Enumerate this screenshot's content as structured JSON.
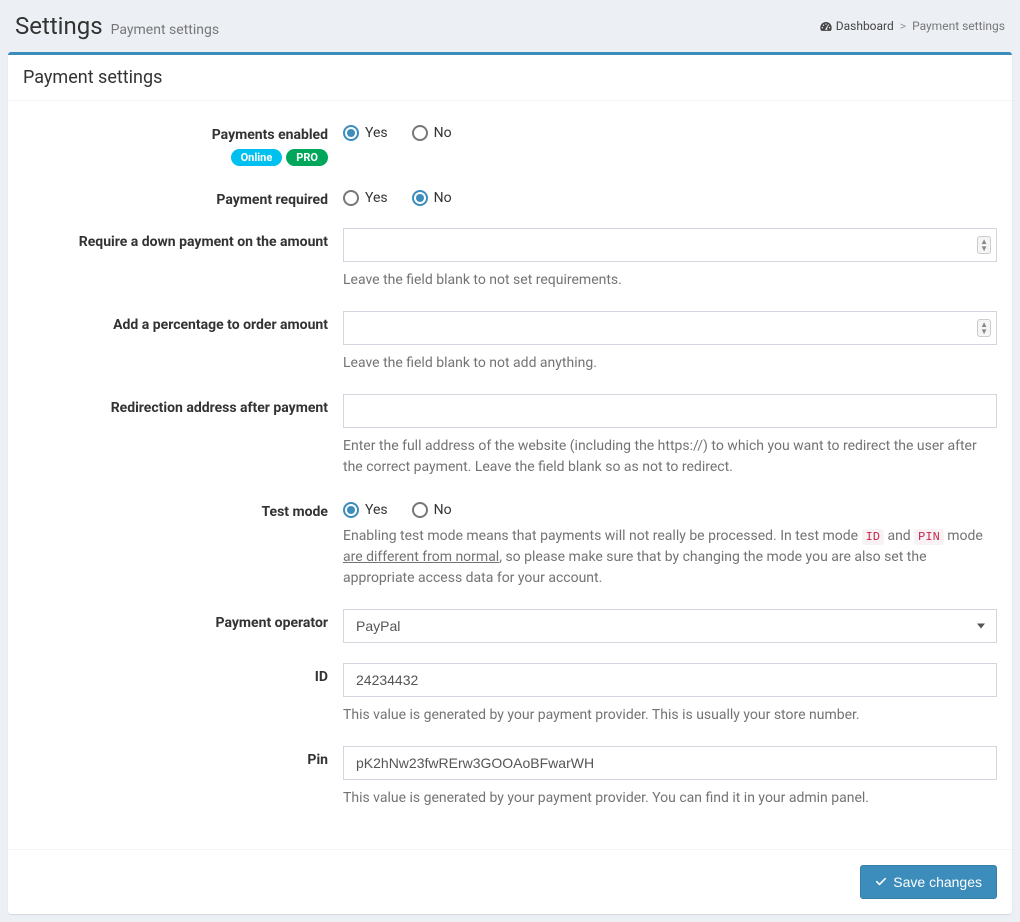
{
  "header": {
    "title": "Settings",
    "subtitle": "Payment settings"
  },
  "breadcrumb": {
    "dashboard_label": "Dashboard",
    "current_label": "Payment settings"
  },
  "panel": {
    "title": "Payment settings"
  },
  "badges": {
    "online": "Online",
    "pro": "PRO"
  },
  "labels": {
    "payments_enabled": "Payments enabled",
    "payment_required": "Payment required",
    "require_down_payment": "Require a down payment on the amount",
    "add_percentage": "Add a percentage to order amount",
    "redirection_address": "Redirection address after payment",
    "test_mode": "Test mode",
    "payment_operator": "Payment operator",
    "id": "ID",
    "pin": "Pin"
  },
  "radio": {
    "yes": "Yes",
    "no": "No"
  },
  "values": {
    "payments_enabled": "Yes",
    "payment_required": "No",
    "require_down_payment": "",
    "add_percentage": "",
    "redirection_address": "",
    "test_mode": "Yes",
    "payment_operator": "PayPal",
    "id": "24234432",
    "pin": "pK2hNw23fwRErw3GOOAoBFwarWH"
  },
  "help": {
    "require_down_payment": "Leave the field blank to not set requirements.",
    "add_percentage": "Leave the field blank to not add anything.",
    "redirection_address": "Enter the full address of the website (including the https://) to which you want to redirect the user after the correct payment. Leave the field blank so as not to redirect.",
    "test_mode_part1": "Enabling test mode means that payments will not really be processed. In test mode ",
    "test_mode_code1": "ID",
    "test_mode_part2": " and ",
    "test_mode_code2": "PIN",
    "test_mode_part3": " mode ",
    "test_mode_underline": "are different from normal",
    "test_mode_part4": ", so please make sure that by changing the mode you are also set the appropriate access data for your account.",
    "id": "This value is generated by your payment provider. This is usually your store number.",
    "pin": "This value is generated by your payment provider. You can find it in your admin panel."
  },
  "footer": {
    "save_label": "Save changes"
  }
}
